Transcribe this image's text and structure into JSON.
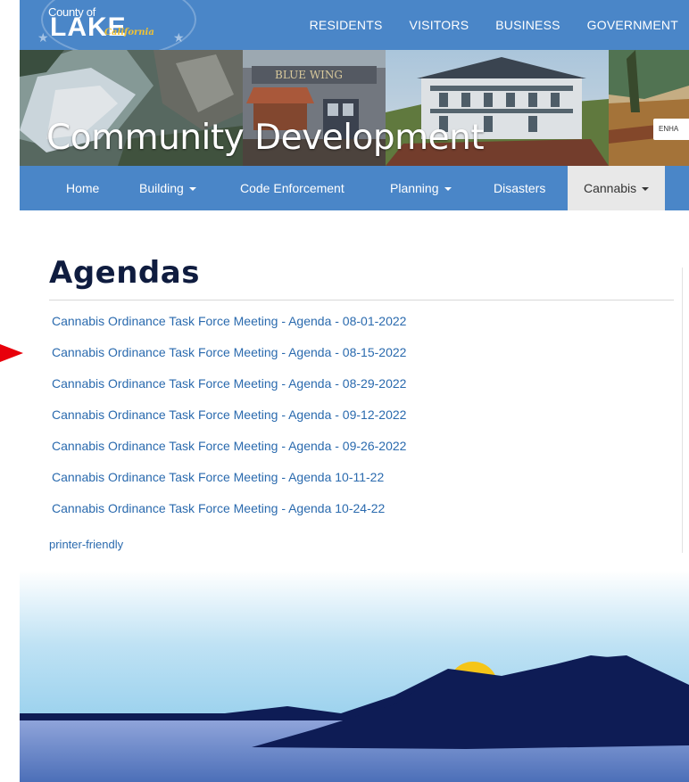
{
  "logo": {
    "county_text": "County of",
    "lake_text": "LAKE",
    "state_text": "California"
  },
  "top_nav": [
    "RESIDENTS",
    "VISITORS",
    "BUSINESS",
    "GOVERNMENT"
  ],
  "banner": {
    "title": "Community Development",
    "sign_text": "BLUE WING",
    "enhance_label": "ENHA"
  },
  "main_nav": [
    {
      "label": "Home",
      "has_dropdown": false
    },
    {
      "label": "Building",
      "has_dropdown": true
    },
    {
      "label": "Code Enforcement",
      "has_dropdown": false
    },
    {
      "label": "Planning",
      "has_dropdown": true
    },
    {
      "label": "Disasters",
      "has_dropdown": false
    },
    {
      "label": "Cannabis",
      "has_dropdown": true,
      "active": true
    }
  ],
  "page": {
    "title": "Agendas",
    "agendas": [
      "Cannabis Ordinance Task Force Meeting - Agenda - 08-01-2022",
      "Cannabis Ordinance Task Force Meeting - Agenda - 08-15-2022",
      "Cannabis Ordinance Task Force Meeting - Agenda - 08-29-2022",
      "Cannabis Ordinance Task Force Meeting - Agenda - 09-12-2022",
      "Cannabis Ordinance Task Force Meeting - Agenda - 09-26-2022",
      "Cannabis Ordinance Task Force Meeting - Agenda 10-11-22",
      "Cannabis Ordinance Task Force Meeting - Agenda 10-24-22"
    ],
    "printer_label": "printer-friendly"
  },
  "colors": {
    "nav_blue": "#4a86c8",
    "link_blue": "#2a6aae",
    "title_navy": "#0f1c3f",
    "arrow_red": "#e8000b",
    "sun_yellow": "#f5c518"
  },
  "icons": {
    "pointer": "red-arrow-icon",
    "dropdown": "caret-down-icon"
  }
}
